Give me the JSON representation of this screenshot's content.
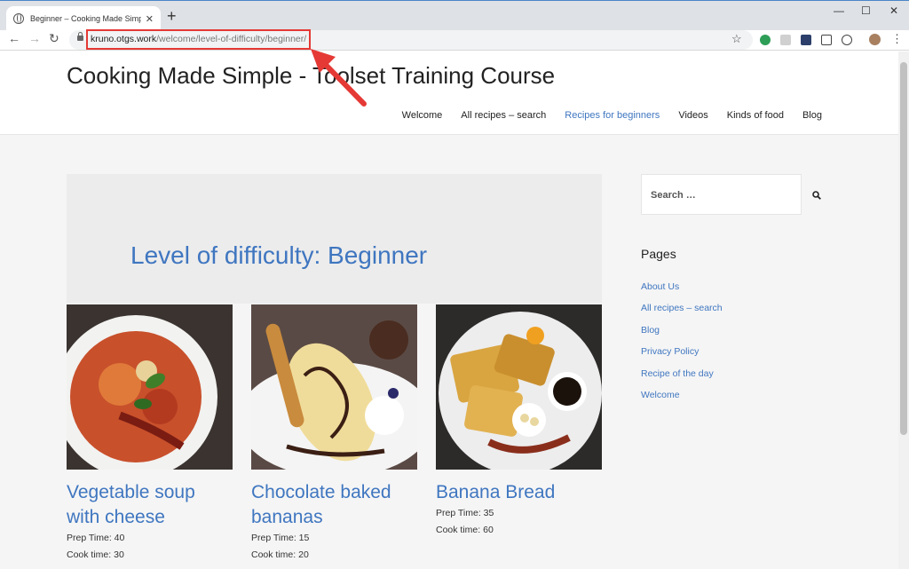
{
  "browser": {
    "tab_title": "Beginner – Cooking Made Simpl",
    "url_host": "kruno.otgs.work",
    "url_path": "/welcome/level-of-difficulty/beginner/"
  },
  "site": {
    "title": "Cooking Made Simple - Toolset Training Course",
    "menu": [
      "Welcome",
      "All recipes – search",
      "Recipes for beginners",
      "Videos",
      "Kinds of food",
      "Blog"
    ],
    "active_menu": "Recipes for beginners"
  },
  "hero": {
    "title": "Level of difficulty: Beginner"
  },
  "cards": [
    {
      "title_line1": "Vegetable soup",
      "title_line2": "with cheese",
      "prep": "Prep Time: 40",
      "cook": "Cook time: 30"
    },
    {
      "title_line1": "Chocolate baked",
      "title_line2": "bananas",
      "prep": "Prep Time: 15",
      "cook": "Cook time: 20"
    },
    {
      "title_line1": "Banana Bread",
      "title_line2": "",
      "prep": "Prep Time: 35",
      "cook": "Cook time: 60"
    }
  ],
  "sidebar": {
    "search_placeholder": "Search …",
    "pages_heading": "Pages",
    "pages": [
      "About Us",
      "All recipes – search",
      "Blog",
      "Privacy Policy",
      "Recipe of the day",
      "Welcome"
    ]
  },
  "colors": {
    "link": "#3f76c0",
    "highlight": "#e53935"
  },
  "icons": [
    "globe-icon",
    "close-icon",
    "plus-icon",
    "back-icon",
    "forward-icon",
    "reload-icon",
    "lock-icon",
    "star-icon",
    "search-icon",
    "menu-dots-icon"
  ]
}
